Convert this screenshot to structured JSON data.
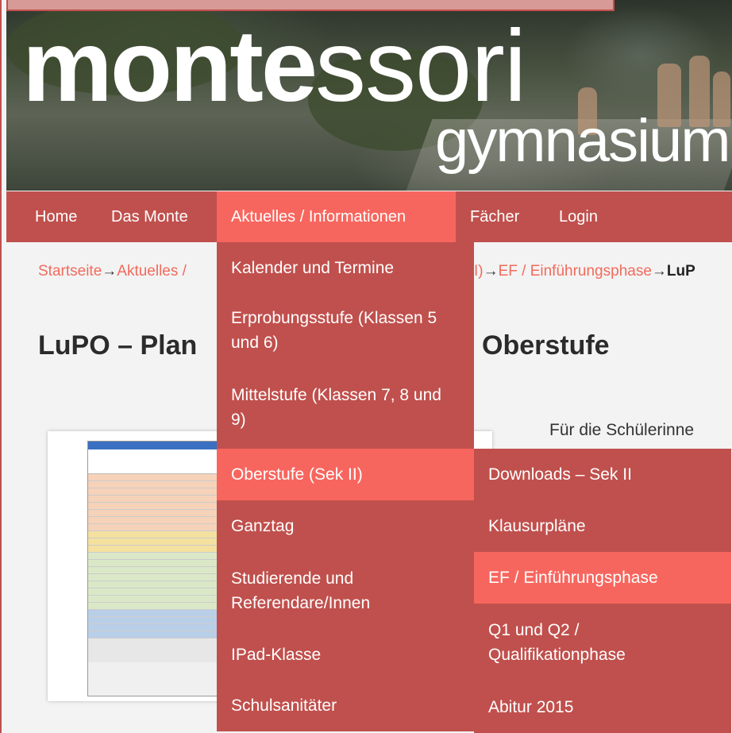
{
  "header": {
    "logo_bold": "monte",
    "logo_light": "ssori",
    "logo_sub": "gymnasium"
  },
  "nav": {
    "items": [
      {
        "label": "Home"
      },
      {
        "label": "Das Monte"
      },
      {
        "label": "Aktuelles / Informationen"
      },
      {
        "label": "Fächer"
      },
      {
        "label": "Login"
      }
    ]
  },
  "dropdown": {
    "items": [
      {
        "label": "Kalender und Termine"
      },
      {
        "label": "Erprobungsstufe (Klassen 5 und 6)"
      },
      {
        "label": "Mittelstufe (Klassen 7, 8 und 9)"
      },
      {
        "label": "Oberstufe (Sek II)"
      },
      {
        "label": "Ganztag"
      },
      {
        "label": "Studierende und Referendare/Innen"
      },
      {
        "label": "IPad-Klasse"
      },
      {
        "label": "Schulsanitäter"
      }
    ]
  },
  "submenu": {
    "items": [
      {
        "label": "Downloads – Sek II"
      },
      {
        "label": "Klausurpläne"
      },
      {
        "label": "EF / Einführungsphase"
      },
      {
        "label": "Q1 und Q2 / Qualifikationphase"
      },
      {
        "label": "Abitur 2015"
      }
    ]
  },
  "breadcrumb": {
    "home": "Startseite",
    "aktuelles": "Aktuelles /",
    "hidden_tail": "I)",
    "ef": "EF / Einführungsphase",
    "current": "LuP",
    "arrow": "→"
  },
  "page": {
    "title_left": "LuPO – Plan",
    "title_right": "Oberstufe",
    "intro": "Für die Schülerinne"
  }
}
